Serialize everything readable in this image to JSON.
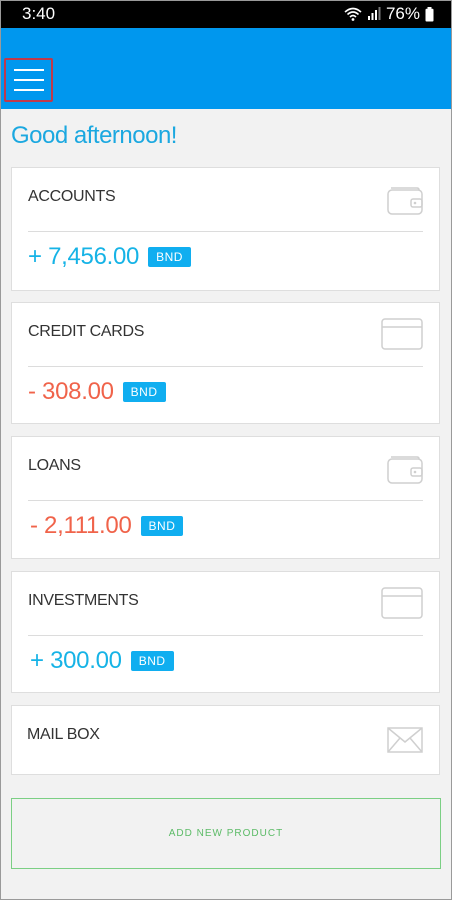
{
  "status_bar": {
    "time": "3:40",
    "battery": "76%",
    "icons": [
      "wifi-icon",
      "signal-icon",
      "battery-icon"
    ]
  },
  "header": {
    "menu_icon": "menu-icon",
    "accent_color": "#0097ee"
  },
  "greeting": "Good afternoon!",
  "cards": [
    {
      "title": "ACCOUNTS",
      "amount": "+ 7,456.00",
      "currency": "BND",
      "icon": "wallet-icon",
      "sign": "positive"
    },
    {
      "title": "CREDIT CARDS",
      "amount": "- 308.00",
      "currency": "BND",
      "icon": "credit-card-icon",
      "sign": "negative"
    },
    {
      "title": "LOANS",
      "amount": "- 2,111.00",
      "currency": "BND",
      "icon": "wallet-icon",
      "sign": "negative"
    },
    {
      "title": "INVESTMENTS",
      "amount": "+ 300.00",
      "currency": "BND",
      "icon": "credit-card-icon",
      "sign": "positive"
    },
    {
      "title": "MAIL BOX",
      "icon": "mail-icon"
    }
  ],
  "add_product_label": "ADD NEW PRODUCT",
  "colors": {
    "positive": "#16b3e6",
    "negative": "#f0634a",
    "badge": "#10aef0",
    "add_border": "#7bcf84"
  }
}
